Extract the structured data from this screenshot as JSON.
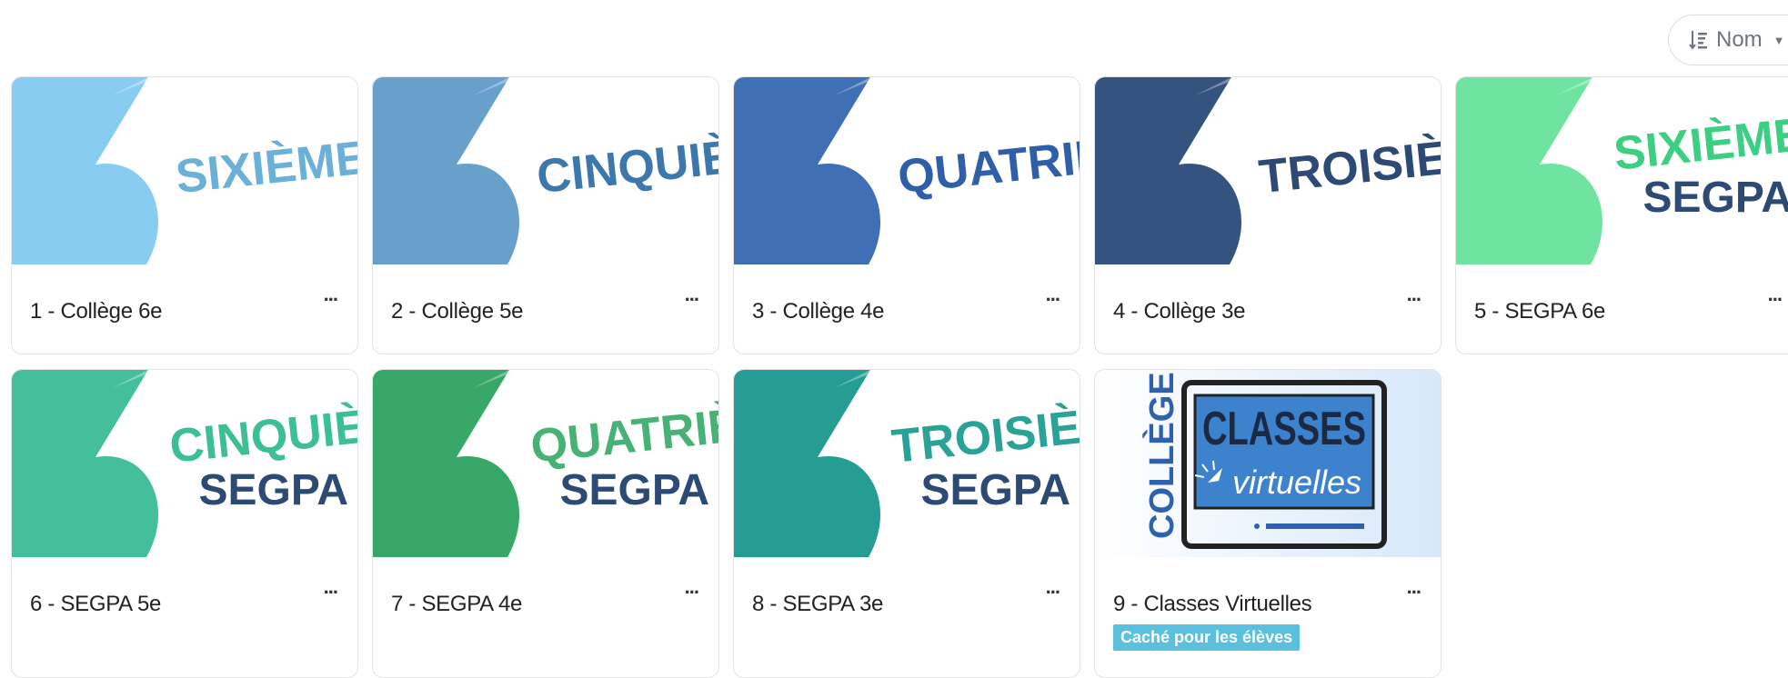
{
  "sort": {
    "label": "Nom",
    "icon": "sort-icon"
  },
  "cards": [
    {
      "name": "1 - Collège 6e",
      "title": "SIXIÈME",
      "subtitle": "",
      "bg": "#89ccf2",
      "text_color": "#6bb0d6"
    },
    {
      "name": "2 - Collège 5e",
      "title": "CINQUIÈM",
      "subtitle": "",
      "bg": "#68a0cc",
      "text_color": "#3d78ad"
    },
    {
      "name": "3 - Collège 4e",
      "title": "QUATRIÈM",
      "subtitle": "",
      "bg": "#3f6fb5",
      "text_color": "#2f5fa8"
    },
    {
      "name": "4 - Collège 3e",
      "title": "TROISIÈM",
      "subtitle": "",
      "bg": "#35537f",
      "text_color": "#2d4a74"
    },
    {
      "name": "5 - SEGPA 6e",
      "title": "SIXIÈME",
      "subtitle": "SEGPA",
      "bg": "#6fe4a1",
      "text_color": "#3ccf84",
      "sub_color": "#2d4a74"
    },
    {
      "name": "6 - SEGPA 5e",
      "title": "CINQUIÈM",
      "subtitle": "SEGPA",
      "bg": "#43bf9b",
      "text_color": "#3bbf93",
      "sub_color": "#2d4a74"
    },
    {
      "name": "7 - SEGPA 4e",
      "title": "QUATRIÈM",
      "subtitle": "SEGPA",
      "bg": "#38a868",
      "text_color": "#48b276",
      "sub_color": "#2d4a74"
    },
    {
      "name": "8 - SEGPA 3e",
      "title": "TROISIÈM",
      "subtitle": "SEGPA",
      "bg": "#259d92",
      "text_color": "#2aa295",
      "sub_color": "#2d4a74"
    }
  ],
  "virtual_card": {
    "name": "9 - Classes Virtuelles",
    "vertical_text": "COLLÈGE",
    "title": "CLASSES",
    "subtitle": "virtuelles",
    "badge": "Caché pour les élèves"
  },
  "more_label": "..."
}
